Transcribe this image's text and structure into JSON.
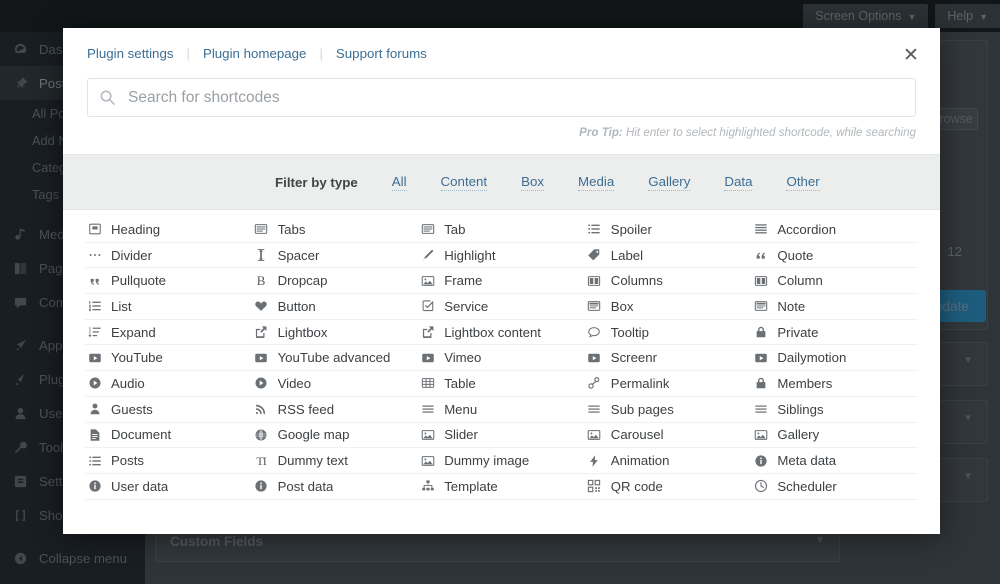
{
  "adminbar": {
    "screen_options": "Screen Options",
    "help": "Help",
    "caret": "▼"
  },
  "sidebar": {
    "items": [
      {
        "label": "Dashboard",
        "icon": "dashboard-icon",
        "current": false
      },
      {
        "label": "Posts",
        "icon": "pin-icon",
        "current": true
      },
      {
        "label": "All Posts",
        "icon": "",
        "sub": true
      },
      {
        "label": "Add New",
        "icon": "",
        "sub": true
      },
      {
        "label": "Categories",
        "icon": "",
        "sub": true
      },
      {
        "label": "Tags",
        "icon": "",
        "sub": true
      },
      {
        "label": "Media",
        "icon": "media-icon",
        "current": false
      },
      {
        "label": "Pages",
        "icon": "pages-icon",
        "current": false
      },
      {
        "label": "Comments",
        "icon": "comment-icon",
        "current": false
      },
      {
        "label": "Appearance",
        "icon": "appearance-icon",
        "current": false
      },
      {
        "label": "Plugins",
        "icon": "plugins-icon",
        "current": false
      },
      {
        "label": "Users",
        "icon": "users-icon",
        "current": false
      },
      {
        "label": "Tools",
        "icon": "tools-icon",
        "current": false
      },
      {
        "label": "Settings",
        "icon": "settings-icon",
        "current": false
      },
      {
        "label": "Shortcodes",
        "icon": "brackets-icon",
        "current": false
      },
      {
        "label": "Collapse menu",
        "icon": "collapse-icon",
        "current": false
      }
    ]
  },
  "background": {
    "revisions_btn": "Browse",
    "date_text": "12",
    "update_btn": "Update",
    "custom_fields_panel": "Custom Fields",
    "caret": "▼"
  },
  "modal": {
    "close_label": "✕",
    "links": [
      {
        "label": "Plugin settings"
      },
      {
        "label": "Plugin homepage"
      },
      {
        "label": "Support forums"
      }
    ],
    "link_divider": "|",
    "search": {
      "placeholder": "Search for shortcodes",
      "value": "",
      "icon": "search-icon"
    },
    "protip": {
      "prefix": "Pro Tip:",
      "text": " Hit enter to select highlighted shortcode, while searching"
    },
    "filter": {
      "label": "Filter by type",
      "options": [
        "All",
        "Content",
        "Box",
        "Media",
        "Gallery",
        "Data",
        "Other"
      ],
      "selected": "All"
    },
    "shortcodes": [
      {
        "label": "Heading",
        "icon": "heading-icon"
      },
      {
        "label": "Tabs",
        "icon": "tabs-icon"
      },
      {
        "label": "Tab",
        "icon": "tab-icon"
      },
      {
        "label": "Spoiler",
        "icon": "list-bullets-icon"
      },
      {
        "label": "Accordion",
        "icon": "accordion-icon"
      },
      {
        "label": "Divider",
        "icon": "dots-icon"
      },
      {
        "label": "Spacer",
        "icon": "arrows-vertical-icon"
      },
      {
        "label": "Highlight",
        "icon": "pencil-icon"
      },
      {
        "label": "Label",
        "icon": "tag-icon"
      },
      {
        "label": "Quote",
        "icon": "quote-icon"
      },
      {
        "label": "Pullquote",
        "icon": "quote-left-icon"
      },
      {
        "label": "Dropcap",
        "icon": "letter-b-icon"
      },
      {
        "label": "Frame",
        "icon": "image-icon"
      },
      {
        "label": "Columns",
        "icon": "columns-icon"
      },
      {
        "label": "Column",
        "icon": "columns-icon"
      },
      {
        "label": "List",
        "icon": "ordered-list-icon"
      },
      {
        "label": "Button",
        "icon": "heart-icon"
      },
      {
        "label": "Service",
        "icon": "checkbox-icon"
      },
      {
        "label": "Box",
        "icon": "box-icon"
      },
      {
        "label": "Note",
        "icon": "box-icon"
      },
      {
        "label": "Expand",
        "icon": "sort-list-icon"
      },
      {
        "label": "Lightbox",
        "icon": "external-link-icon"
      },
      {
        "label": "Lightbox content",
        "icon": "external-link-icon"
      },
      {
        "label": "Tooltip",
        "icon": "speech-bubble-icon"
      },
      {
        "label": "Private",
        "icon": "lock-icon"
      },
      {
        "label": "YouTube",
        "icon": "video-play-icon"
      },
      {
        "label": "YouTube advanced",
        "icon": "video-play-icon"
      },
      {
        "label": "Vimeo",
        "icon": "video-play-icon"
      },
      {
        "label": "Screenr",
        "icon": "video-play-icon"
      },
      {
        "label": "Dailymotion",
        "icon": "video-play-icon"
      },
      {
        "label": "Audio",
        "icon": "play-circle-icon"
      },
      {
        "label": "Video",
        "icon": "play-circle-icon"
      },
      {
        "label": "Table",
        "icon": "table-icon"
      },
      {
        "label": "Permalink",
        "icon": "link-icon"
      },
      {
        "label": "Members",
        "icon": "lock-icon"
      },
      {
        "label": "Guests",
        "icon": "user-icon"
      },
      {
        "label": "RSS feed",
        "icon": "rss-icon"
      },
      {
        "label": "Menu",
        "icon": "menu-lines-icon"
      },
      {
        "label": "Sub pages",
        "icon": "menu-lines-icon"
      },
      {
        "label": "Siblings",
        "icon": "menu-lines-icon"
      },
      {
        "label": "Document",
        "icon": "document-icon"
      },
      {
        "label": "Google map",
        "icon": "globe-icon"
      },
      {
        "label": "Slider",
        "icon": "image-icon"
      },
      {
        "label": "Carousel",
        "icon": "image-icon"
      },
      {
        "label": "Gallery",
        "icon": "image-icon"
      },
      {
        "label": "Posts",
        "icon": "list-bullets-icon"
      },
      {
        "label": "Dummy text",
        "icon": "text-type-icon"
      },
      {
        "label": "Dummy image",
        "icon": "image-icon"
      },
      {
        "label": "Animation",
        "icon": "bolt-icon"
      },
      {
        "label": "Meta data",
        "icon": "info-icon"
      },
      {
        "label": "User data",
        "icon": "info-icon"
      },
      {
        "label": "Post data",
        "icon": "info-icon"
      },
      {
        "label": "Template",
        "icon": "sitemap-icon"
      },
      {
        "label": "QR code",
        "icon": "qr-icon"
      },
      {
        "label": "Scheduler",
        "icon": "clock-icon"
      }
    ]
  },
  "colors": {
    "link": "#3c6e94",
    "modal_bg": "#ffffff",
    "filter_bar_bg": "#eceded",
    "admin_dark": "#191e23",
    "primary_button": "#1d5c7d"
  }
}
